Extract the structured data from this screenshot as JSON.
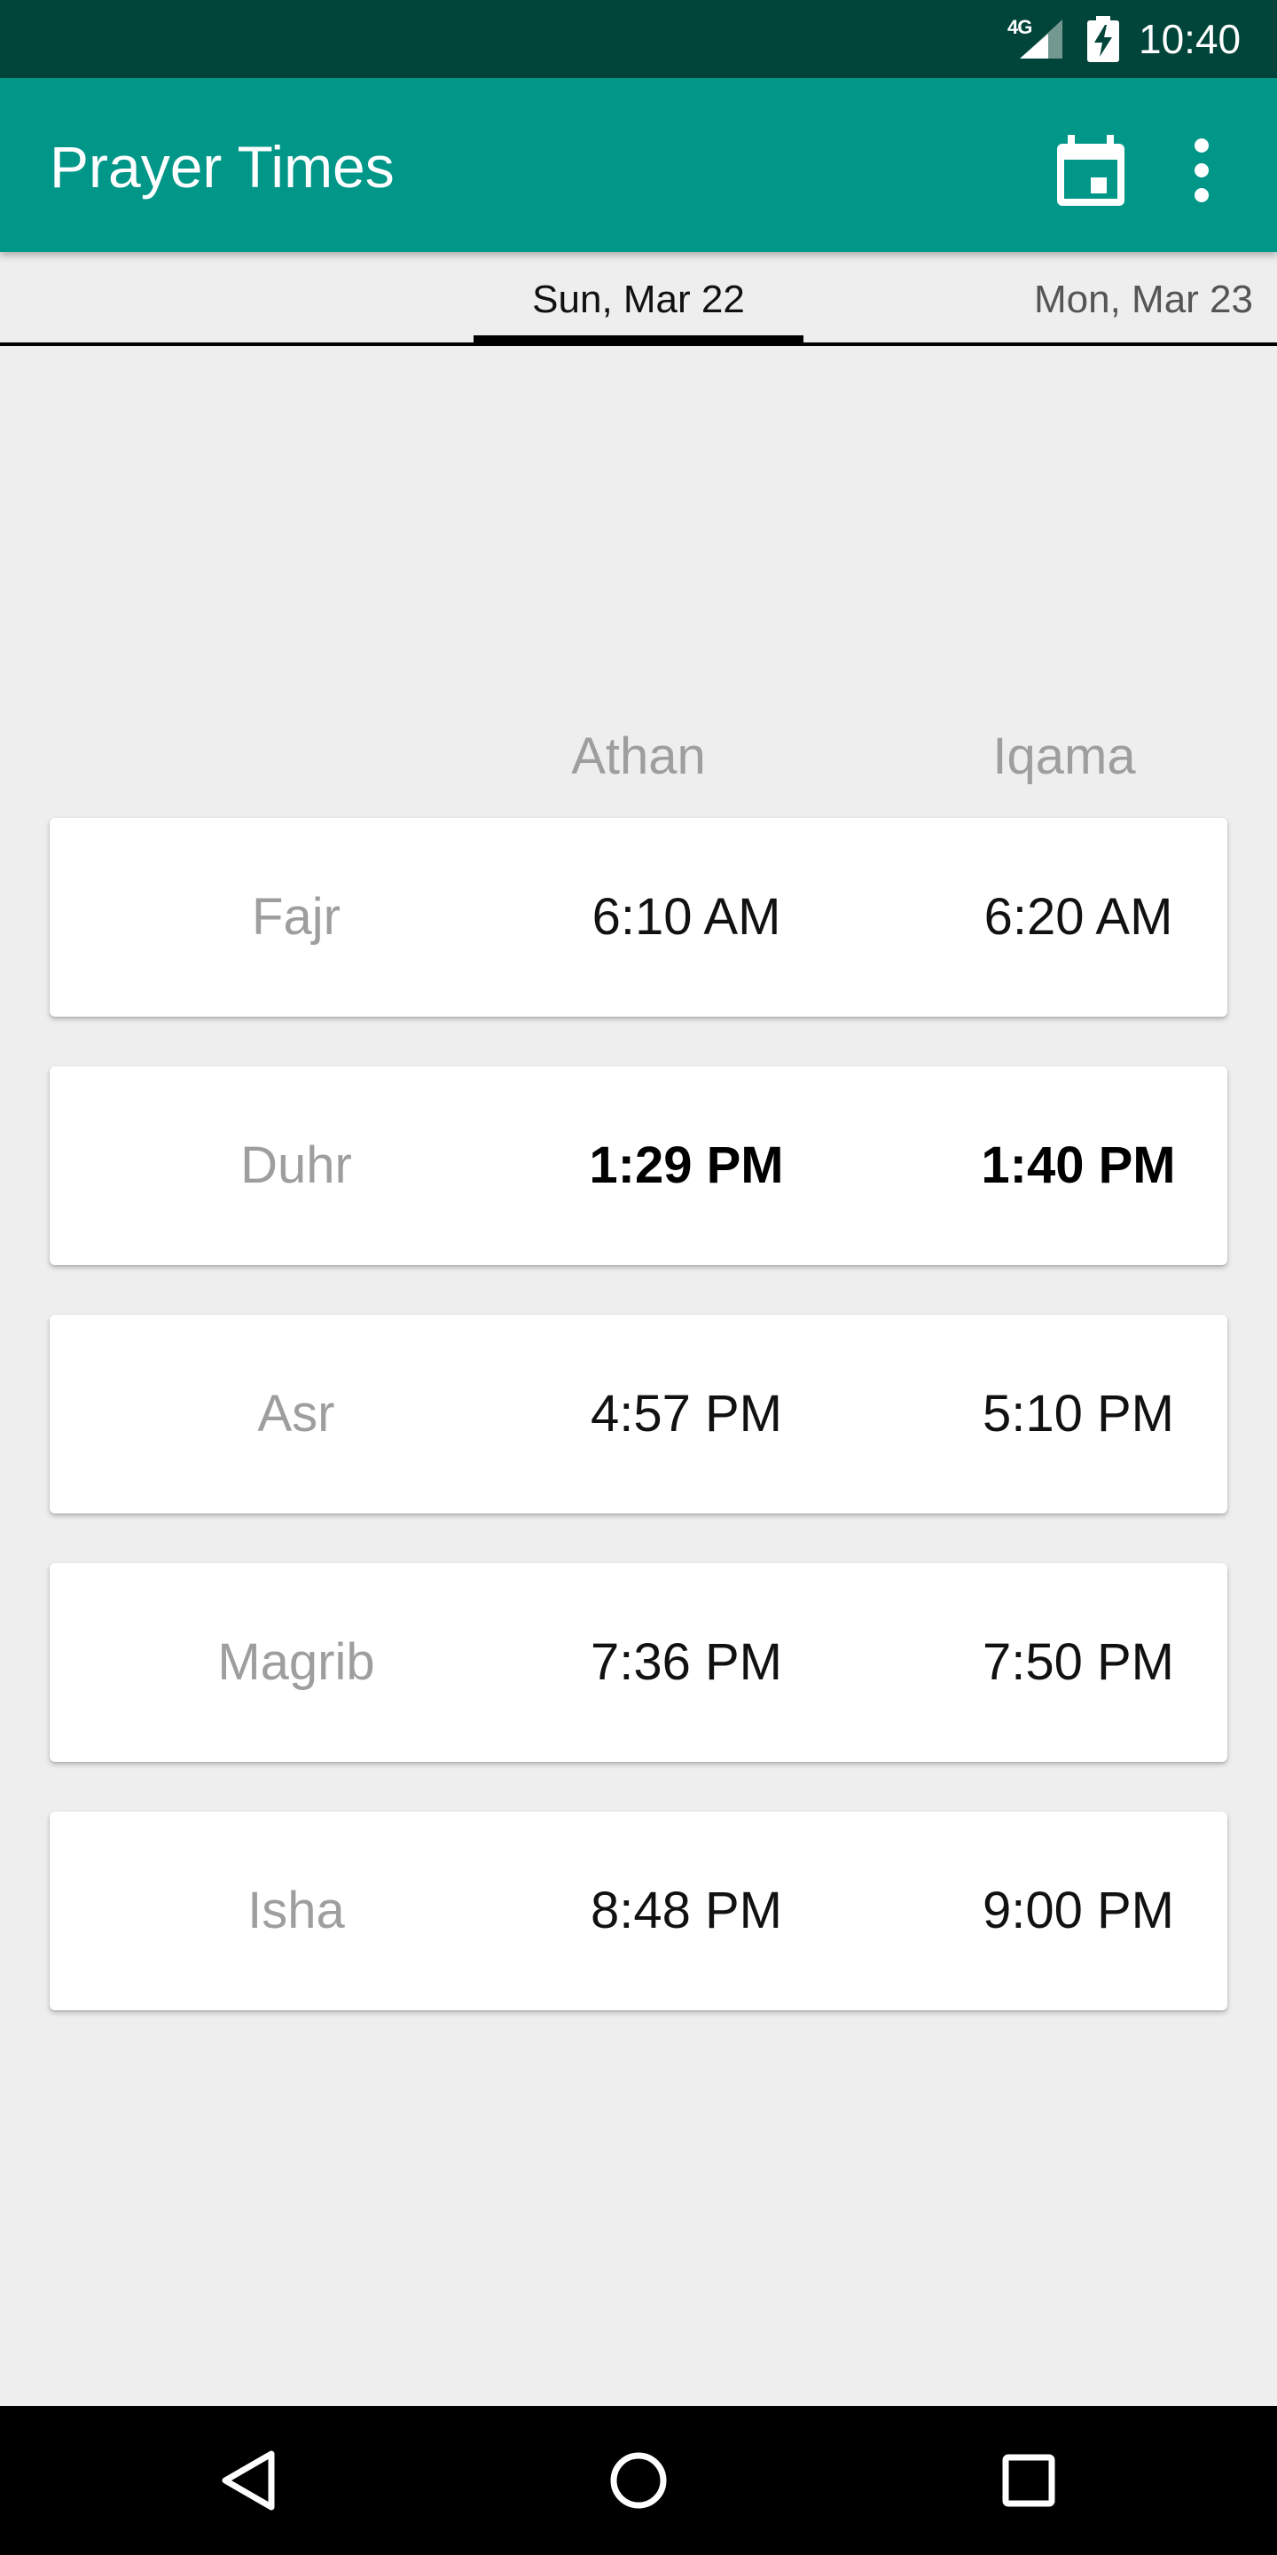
{
  "status_bar": {
    "network": "4G",
    "time": "10:40"
  },
  "app_bar": {
    "title": "Prayer Times",
    "calendar_icon": "calendar-icon",
    "overflow_icon": "more-vert-icon"
  },
  "tabs": [
    {
      "label": "Sun, Mar 22",
      "selected": true
    },
    {
      "label": "Mon, Mar 23",
      "selected": false
    }
  ],
  "columns": {
    "athan": "Athan",
    "iqama": "Iqama"
  },
  "prayers": [
    {
      "name": "Fajr",
      "athan": "6:10 AM",
      "iqama": "6:20 AM",
      "current": false
    },
    {
      "name": "Duhr",
      "athan": "1:29 PM",
      "iqama": "1:40 PM",
      "current": true
    },
    {
      "name": "Asr",
      "athan": "4:57 PM",
      "iqama": "5:10 PM",
      "current": false
    },
    {
      "name": "Magrib",
      "athan": "7:36 PM",
      "iqama": "7:50 PM",
      "current": false
    },
    {
      "name": "Isha",
      "athan": "8:48 PM",
      "iqama": "9:00 PM",
      "current": false
    }
  ],
  "colors": {
    "status_bar": "#00443a",
    "app_bar": "#009688",
    "background": "#eeeeee"
  }
}
